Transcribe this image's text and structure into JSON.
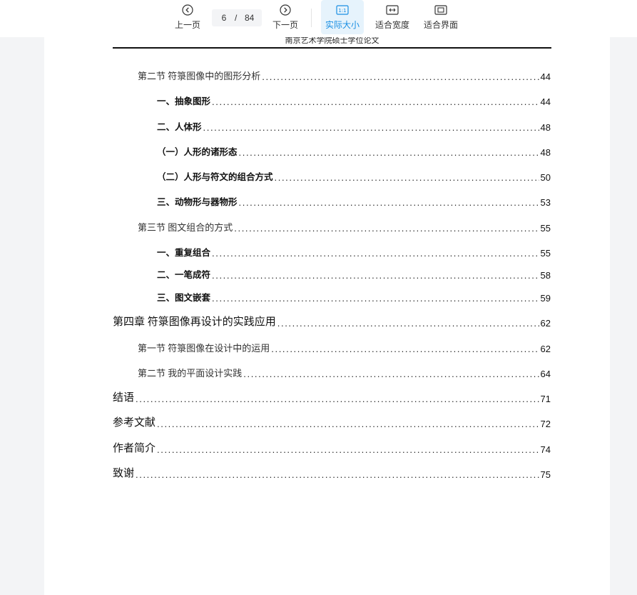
{
  "toolbar": {
    "prev_label": "上一页",
    "next_label": "下一页",
    "current_page": "6",
    "page_separator": "/",
    "total_pages": "84",
    "actual_size_label": "实际大小",
    "actual_size_icon_text": "1:1",
    "fit_width_label": "适合宽度",
    "fit_page_label": "适合界面",
    "accent_color": "#1a8fe3"
  },
  "document": {
    "header": "南京艺术学院硕士学位论文",
    "toc": [
      {
        "title": "第二节  符箓图像中的图形分析",
        "page": "44",
        "level": "section"
      },
      {
        "title": "一、抽象图形",
        "page": "44",
        "level": "sub"
      },
      {
        "title": "二、人体形",
        "page": "48",
        "level": "sub"
      },
      {
        "title": "（一）人形的诸形态",
        "page": "48",
        "level": "sub"
      },
      {
        "title": "（二）人形与符文的组合方式",
        "page": "50",
        "level": "sub"
      },
      {
        "title": "三、动物形与器物形",
        "page": "53",
        "level": "sub"
      },
      {
        "title": "第三节  图文组合的方式",
        "page": "55",
        "level": "section"
      },
      {
        "title": "一、重复组合",
        "page": "55",
        "level": "sub"
      },
      {
        "title": "二、一笔成符",
        "page": "58",
        "level": "sub"
      },
      {
        "title": "三、图文嵌套",
        "page": "59",
        "level": "sub"
      },
      {
        "title": "第四章  符箓图像再设计的实践应用",
        "page": "62",
        "level": "chapter"
      },
      {
        "title": "第一节  符箓图像在设计中的运用",
        "page": "62",
        "level": "section"
      },
      {
        "title": "第二节  我的平面设计实践",
        "page": "64",
        "level": "section"
      },
      {
        "title": "结语",
        "page": "71",
        "level": "chapter"
      },
      {
        "title": "参考文献",
        "page": "72",
        "level": "chapter"
      },
      {
        "title": "作者简介",
        "page": "74",
        "level": "chapter"
      },
      {
        "title": "致谢",
        "page": "75",
        "level": "chapter"
      }
    ]
  }
}
